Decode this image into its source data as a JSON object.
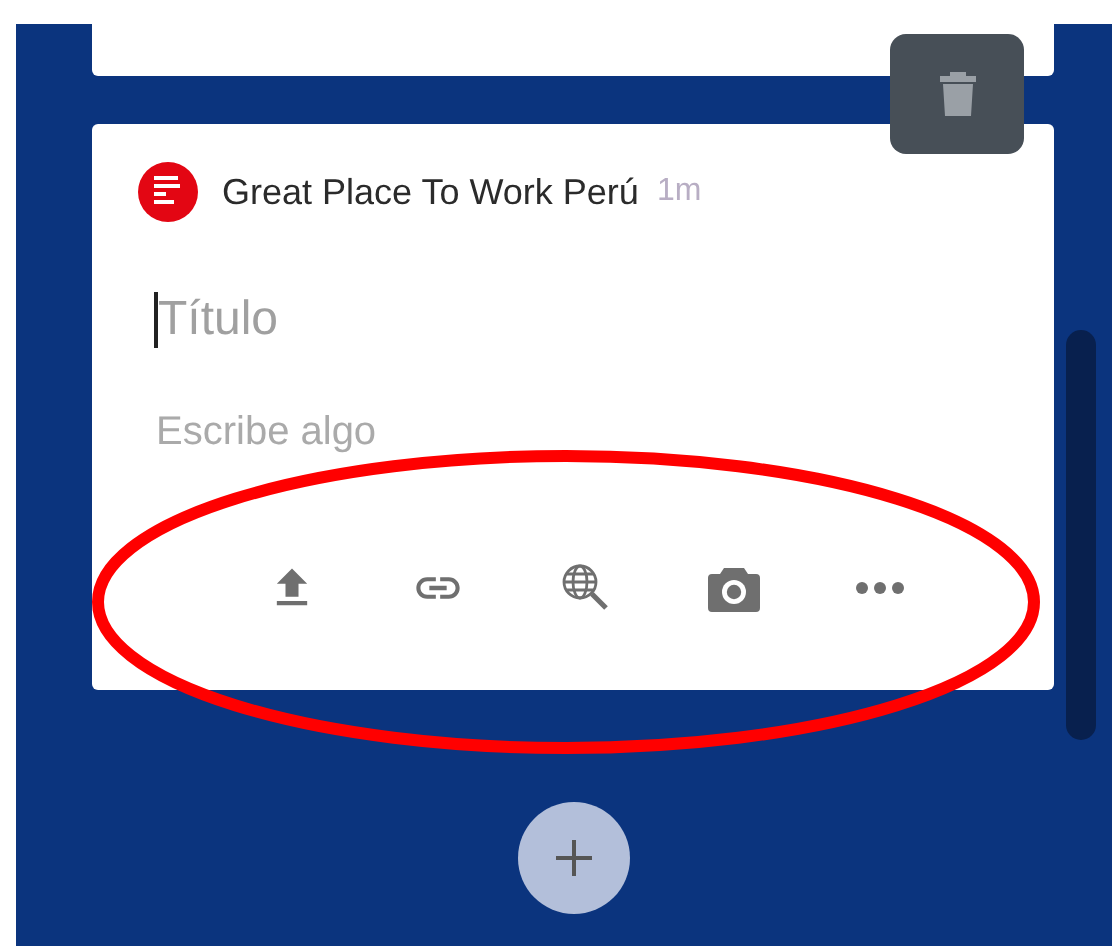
{
  "post": {
    "author": "Great Place To Work Perú",
    "time": "1m",
    "title": {
      "placeholder": "Título",
      "focused": true
    },
    "body": {
      "placeholder": "Escribe algo"
    },
    "toolbar": [
      {
        "kind": "upload"
      },
      {
        "kind": "link"
      },
      {
        "kind": "web-search"
      },
      {
        "kind": "camera"
      },
      {
        "kind": "more"
      }
    ]
  },
  "annotation": {
    "kind": "ellipse",
    "color": "#ff0000"
  }
}
